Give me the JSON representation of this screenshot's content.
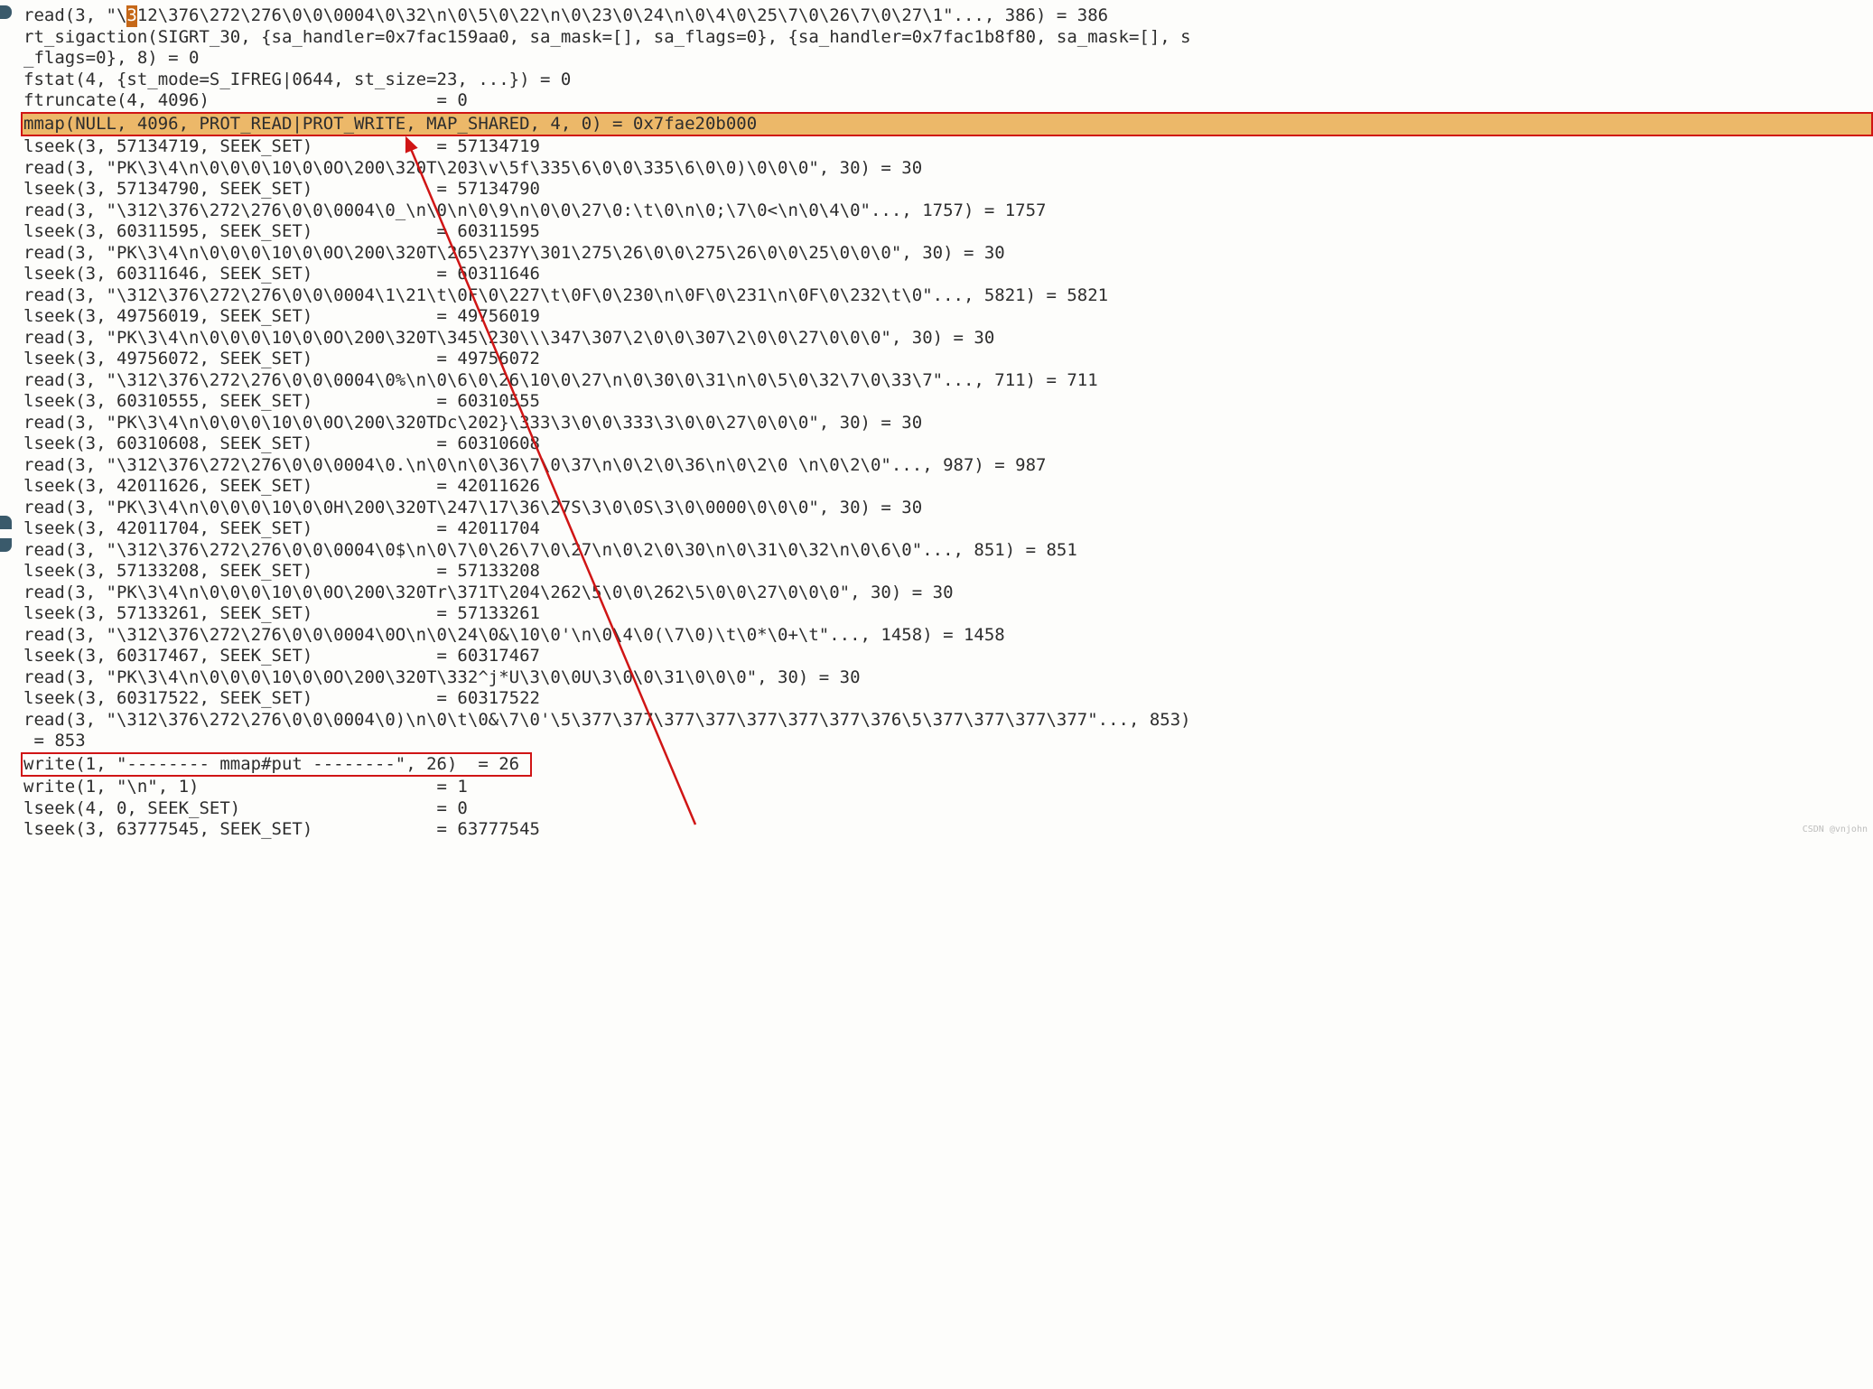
{
  "indicators": [
    {
      "class": "indicator-1"
    },
    {
      "class": "indicator-2"
    },
    {
      "class": "indicator-3"
    }
  ],
  "cursor_pre": "read(3, \"\\",
  "cursor_char": "3",
  "cursor_post": "12\\376\\272\\276\\0\\0\\0004\\0\\32\\n\\0\\5\\0\\22\\n\\0\\23\\0\\24\\n\\0\\4\\0\\25\\7\\0\\26\\7\\0\\27\\1\"..., 386) = 386",
  "lines": {
    "l1": "rt_sigaction(SIGRT_30, {sa_handler=0x7fac159aa0, sa_mask=[], sa_flags=0}, {sa_handler=0x7fac1b8f80, sa_mask=[], s",
    "l2": "_flags=0}, 8) = 0",
    "l3": "fstat(4, {st_mode=S_IFREG|0644, st_size=23, ...}) = 0",
    "l4": "ftruncate(4, 4096)                      = 0",
    "l5": "mmap(NULL, 4096, PROT_READ|PROT_WRITE, MAP_SHARED, 4, 0) = 0x7fae20b000   ",
    "l6": "lseek(3, 57134719, SEEK_SET)            = 57134719",
    "l7": "read(3, \"PK\\3\\4\\n\\0\\0\\0\\10\\0\\0O\\200\\320T\\203\\v\\5f\\335\\6\\0\\0\\335\\6\\0\\0)\\0\\0\\0\", 30) = 30",
    "l8": "lseek(3, 57134790, SEEK_SET)            = 57134790",
    "l9": "read(3, \"\\312\\376\\272\\276\\0\\0\\0004\\0_\\n\\0\\n\\0\\9\\n\\0\\0\\27\\0:\\t\\0\\n\\0;\\7\\0<\\n\\0\\4\\0\"..., 1757) = 1757",
    "l10": "lseek(3, 60311595, SEEK_SET)            = 60311595",
    "l11": "read(3, \"PK\\3\\4\\n\\0\\0\\0\\10\\0\\0O\\200\\320T\\265\\237Y\\301\\275\\26\\0\\0\\275\\26\\0\\0\\25\\0\\0\\0\", 30) = 30",
    "l12": "lseek(3, 60311646, SEEK_SET)            = 60311646",
    "l13": "read(3, \"\\312\\376\\272\\276\\0\\0\\0004\\1\\21\\t\\0F\\0\\227\\t\\0F\\0\\230\\n\\0F\\0\\231\\n\\0F\\0\\232\\t\\0\"..., 5821) = 5821",
    "l14": "lseek(3, 49756019, SEEK_SET)            = 49756019",
    "l15": "read(3, \"PK\\3\\4\\n\\0\\0\\0\\10\\0\\0O\\200\\320T\\345\\230\\\\\\347\\307\\2\\0\\0\\307\\2\\0\\0\\27\\0\\0\\0\", 30) = 30",
    "l16": "lseek(3, 49756072, SEEK_SET)            = 49756072",
    "l17": "read(3, \"\\312\\376\\272\\276\\0\\0\\0004\\0%\\n\\0\\6\\0\\26\\10\\0\\27\\n\\0\\30\\0\\31\\n\\0\\5\\0\\32\\7\\0\\33\\7\"..., 711) = 711",
    "l18": "lseek(3, 60310555, SEEK_SET)            = 60310555",
    "l19": "read(3, \"PK\\3\\4\\n\\0\\0\\0\\10\\0\\0O\\200\\320TDc\\202}\\333\\3\\0\\0\\333\\3\\0\\0\\27\\0\\0\\0\", 30) = 30",
    "l20": "lseek(3, 60310608, SEEK_SET)            = 60310608",
    "l21": "read(3, \"\\312\\376\\272\\276\\0\\0\\0004\\0.\\n\\0\\n\\0\\36\\7\\0\\37\\n\\0\\2\\0\\36\\n\\0\\2\\0 \\n\\0\\2\\0\"..., 987) = 987",
    "l22": "lseek(3, 42011626, SEEK_SET)            = 42011626",
    "l23": "read(3, \"PK\\3\\4\\n\\0\\0\\0\\10\\0\\0H\\200\\320T\\247\\17\\36\\27S\\3\\0\\0S\\3\\0\\0000\\0\\0\\0\", 30) = 30",
    "l24": "lseek(3, 42011704, SEEK_SET)            = 42011704",
    "l25": "read(3, \"\\312\\376\\272\\276\\0\\0\\0004\\0$\\n\\0\\7\\0\\26\\7\\0\\27\\n\\0\\2\\0\\30\\n\\0\\31\\0\\32\\n\\0\\6\\0\"..., 851) = 851",
    "l26": "lseek(3, 57133208, SEEK_SET)            = 57133208",
    "l27": "read(3, \"PK\\3\\4\\n\\0\\0\\0\\10\\0\\0O\\200\\320Tr\\371T\\204\\262\\5\\0\\0\\262\\5\\0\\0\\27\\0\\0\\0\", 30) = 30",
    "l28": "lseek(3, 57133261, SEEK_SET)            = 57133261",
    "l29": "read(3, \"\\312\\376\\272\\276\\0\\0\\0004\\0O\\n\\0\\24\\0&\\10\\0'\\n\\0\\4\\0(\\7\\0)\\t\\0*\\0+\\t\"..., 1458) = 1458",
    "l30": "lseek(3, 60317467, SEEK_SET)            = 60317467",
    "l31": "read(3, \"PK\\3\\4\\n\\0\\0\\0\\10\\0\\0O\\200\\320T\\332^j*U\\3\\0\\0U\\3\\0\\0\\31\\0\\0\\0\", 30) = 30",
    "l32": "lseek(3, 60317522, SEEK_SET)            = 60317522",
    "l33": "read(3, \"\\312\\376\\272\\276\\0\\0\\0004\\0)\\n\\0\\t\\0&\\7\\0'\\5\\377\\377\\377\\377\\377\\377\\377\\376\\5\\377\\377\\377\\377\"..., 853)",
    "l34": " = 853",
    "l35": "write(1, \"-------- mmap#put --------\", 26)  = 26 ",
    "l36": "write(1, \"\\n\", 1)                       = 1",
    "l37": "lseek(4, 0, SEEK_SET)                   = 0",
    "l38": "lseek(3, 63777545, SEEK_SET)            = 63777545"
  },
  "watermark": "CSDN @vnjohn"
}
